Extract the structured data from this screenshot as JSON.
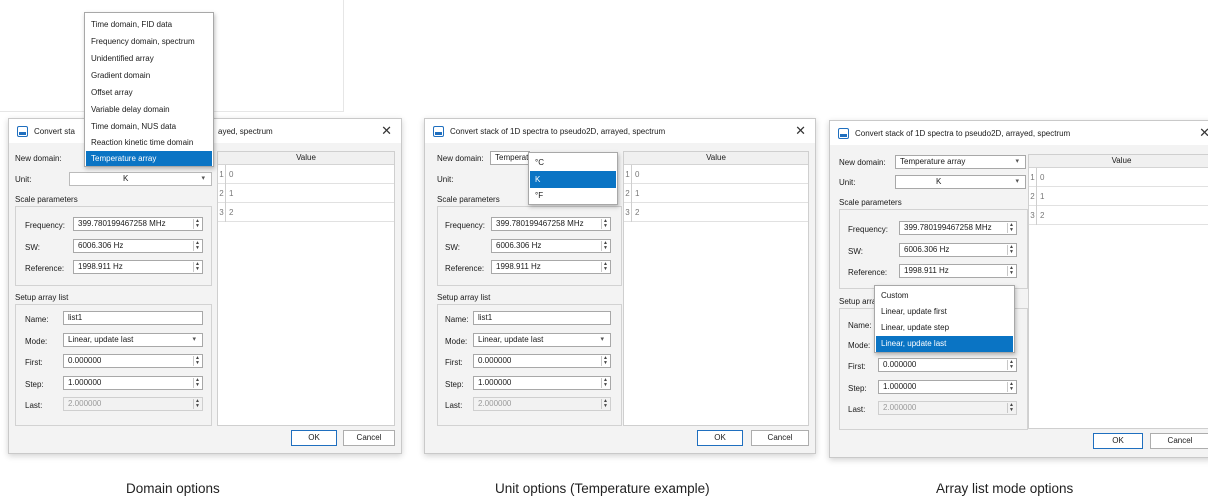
{
  "panels": [
    {
      "title": "Convert stack of 1D spectra to pseudo2D, arrayed, spectrum",
      "title_visible": "Convert sta",
      "title_tail": "ayed, spectrum",
      "labels": {
        "new_domain": "New domain:",
        "unit": "Unit:",
        "scale_parameters": "Scale parameters",
        "frequency": "Frequency:",
        "sw": "SW:",
        "reference": "Reference:",
        "setup_array_list": "Setup array list",
        "name": "Name:",
        "mode": "Mode:",
        "first": "First:",
        "step": "Step:",
        "last": "Last:"
      },
      "values": {
        "unit": "K",
        "frequency": "399.780199467258 MHz",
        "sw": "6006.306 Hz",
        "reference": "1998.911 Hz",
        "name": "list1",
        "mode": "Linear, update last",
        "first": "0.000000",
        "step": "1.000000",
        "last": "2.000000"
      },
      "table": {
        "header": "Value",
        "rows": [
          {
            "num": "1",
            "val": "0"
          },
          {
            "num": "2",
            "val": "1"
          },
          {
            "num": "3",
            "val": "2"
          }
        ]
      },
      "buttons": {
        "ok": "OK",
        "cancel": "Cancel"
      },
      "popup": {
        "options": [
          "Time domain, FID data",
          "Frequency domain, spectrum",
          "Unidentified array",
          "Gradient domain",
          "Offset array",
          "Variable delay domain",
          "Time domain, NUS data",
          "Reaction kinetic time domain",
          "Temperature array"
        ],
        "selected_index": 8
      }
    },
    {
      "title": "Convert stack of 1D spectra to pseudo2D, arrayed, spectrum",
      "labels": {
        "new_domain": "New domain:",
        "unit": "Unit:",
        "scale_parameters": "Scale parameters",
        "frequency": "Frequency:",
        "sw": "SW:",
        "reference": "Reference:",
        "setup_array_list": "Setup array list",
        "name": "Name:",
        "mode": "Mode:",
        "first": "First:",
        "step": "Step:",
        "last": "Last:"
      },
      "values": {
        "domain": "Temperat",
        "frequency": "399.780199467258 MHz",
        "sw": "6006.306 Hz",
        "reference": "1998.911 Hz",
        "name": "list1",
        "mode": "Linear, update last",
        "first": "0.000000",
        "step": "1.000000",
        "last": "2.000000"
      },
      "table": {
        "header": "Value",
        "rows": [
          {
            "num": "1",
            "val": "0"
          },
          {
            "num": "2",
            "val": "1"
          },
          {
            "num": "3",
            "val": "2"
          }
        ]
      },
      "buttons": {
        "ok": "OK",
        "cancel": "Cancel"
      },
      "popup": {
        "options": [
          "°C",
          "K",
          "°F"
        ],
        "selected_index": 1
      }
    },
    {
      "title": "Convert stack of 1D spectra to pseudo2D, arrayed, spectrum",
      "labels": {
        "new_domain": "New domain:",
        "unit": "Unit:",
        "scale_parameters": "Scale parameters",
        "frequency": "Frequency:",
        "sw": "SW:",
        "reference": "Reference:",
        "setup_array_list": "Setup arra",
        "name": "Name:",
        "mode": "Mode:",
        "first": "First:",
        "step": "Step:",
        "last": "Last:"
      },
      "values": {
        "domain": "Temperature array",
        "unit": "K",
        "frequency": "399.780199467258 MHz",
        "sw": "6006.306 Hz",
        "reference": "1998.911 Hz",
        "first": "0.000000",
        "step": "1.000000",
        "last": "2.000000"
      },
      "table": {
        "header": "Value",
        "rows": [
          {
            "num": "1",
            "val": "0"
          },
          {
            "num": "2",
            "val": "1"
          },
          {
            "num": "3",
            "val": "2"
          }
        ]
      },
      "buttons": {
        "ok": "OK",
        "cancel": "Cancel"
      },
      "popup": {
        "options": [
          "Custom",
          "Linear, update first",
          "Linear, update step",
          "Linear, update last"
        ],
        "selected_index": 3
      }
    }
  ],
  "captions": [
    "Domain options",
    "Unit options (Temperature example)",
    "Array list mode options"
  ],
  "colors": {
    "selection": "#0a74c4",
    "accent": "#1f6fbf"
  }
}
